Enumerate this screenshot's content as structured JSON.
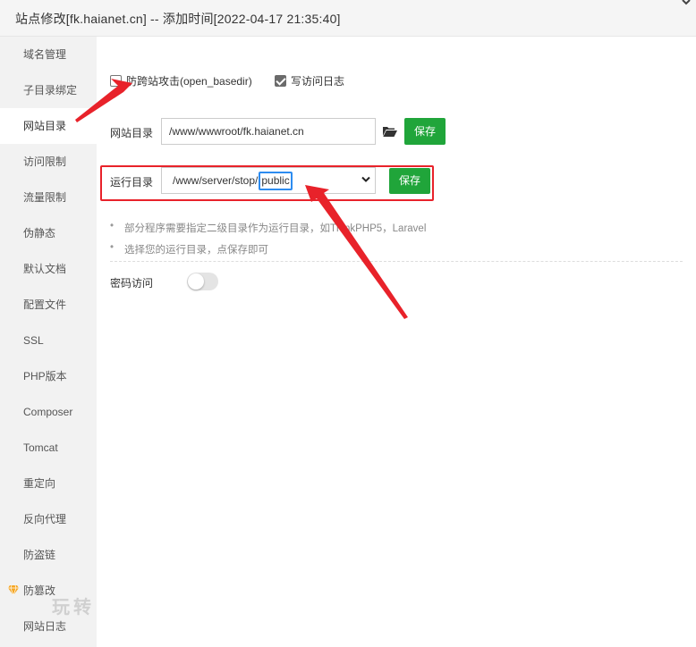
{
  "window": {
    "title": "站点修改[fk.haianet.cn] -- 添加时间[2022-04-17 21:35:40]"
  },
  "sidebar": {
    "items": [
      {
        "label": "域名管理"
      },
      {
        "label": "子目录绑定"
      },
      {
        "label": "网站目录",
        "active": true
      },
      {
        "label": "访问限制"
      },
      {
        "label": "流量限制"
      },
      {
        "label": "伪静态"
      },
      {
        "label": "默认文档"
      },
      {
        "label": "配置文件"
      },
      {
        "label": "SSL"
      },
      {
        "label": "PHP版本"
      },
      {
        "label": "Composer"
      },
      {
        "label": "Tomcat"
      },
      {
        "label": "重定向"
      },
      {
        "label": "反向代理"
      },
      {
        "label": "防盗链"
      },
      {
        "label": "防篡改",
        "icon": "gem-icon"
      },
      {
        "label": "网站日志"
      }
    ],
    "watermark": "玩转"
  },
  "main": {
    "anti_xss_label": "防跨站攻击(open_basedir)",
    "anti_xss_checked": false,
    "access_log_label": "写访问日志",
    "access_log_checked": true,
    "site_dir": {
      "label": "网站目录",
      "value": "/www/wwwroot/fk.haianet.cn",
      "save_label": "保存"
    },
    "run_dir": {
      "label": "运行目录",
      "value_prefix": "/www/server/stop/",
      "value_selected": "public",
      "save_label": "保存"
    },
    "tips": [
      "部分程序需要指定二级目录作为运行目录，如ThinkPHP5，Laravel",
      "选择您的运行目录，点保存即可"
    ],
    "password_access": {
      "label": "密码访问",
      "enabled": false
    }
  },
  "colors": {
    "accent_green": "#20a53a",
    "annotation_red": "#e8222a",
    "highlight_blue": "#2d8cf0"
  }
}
